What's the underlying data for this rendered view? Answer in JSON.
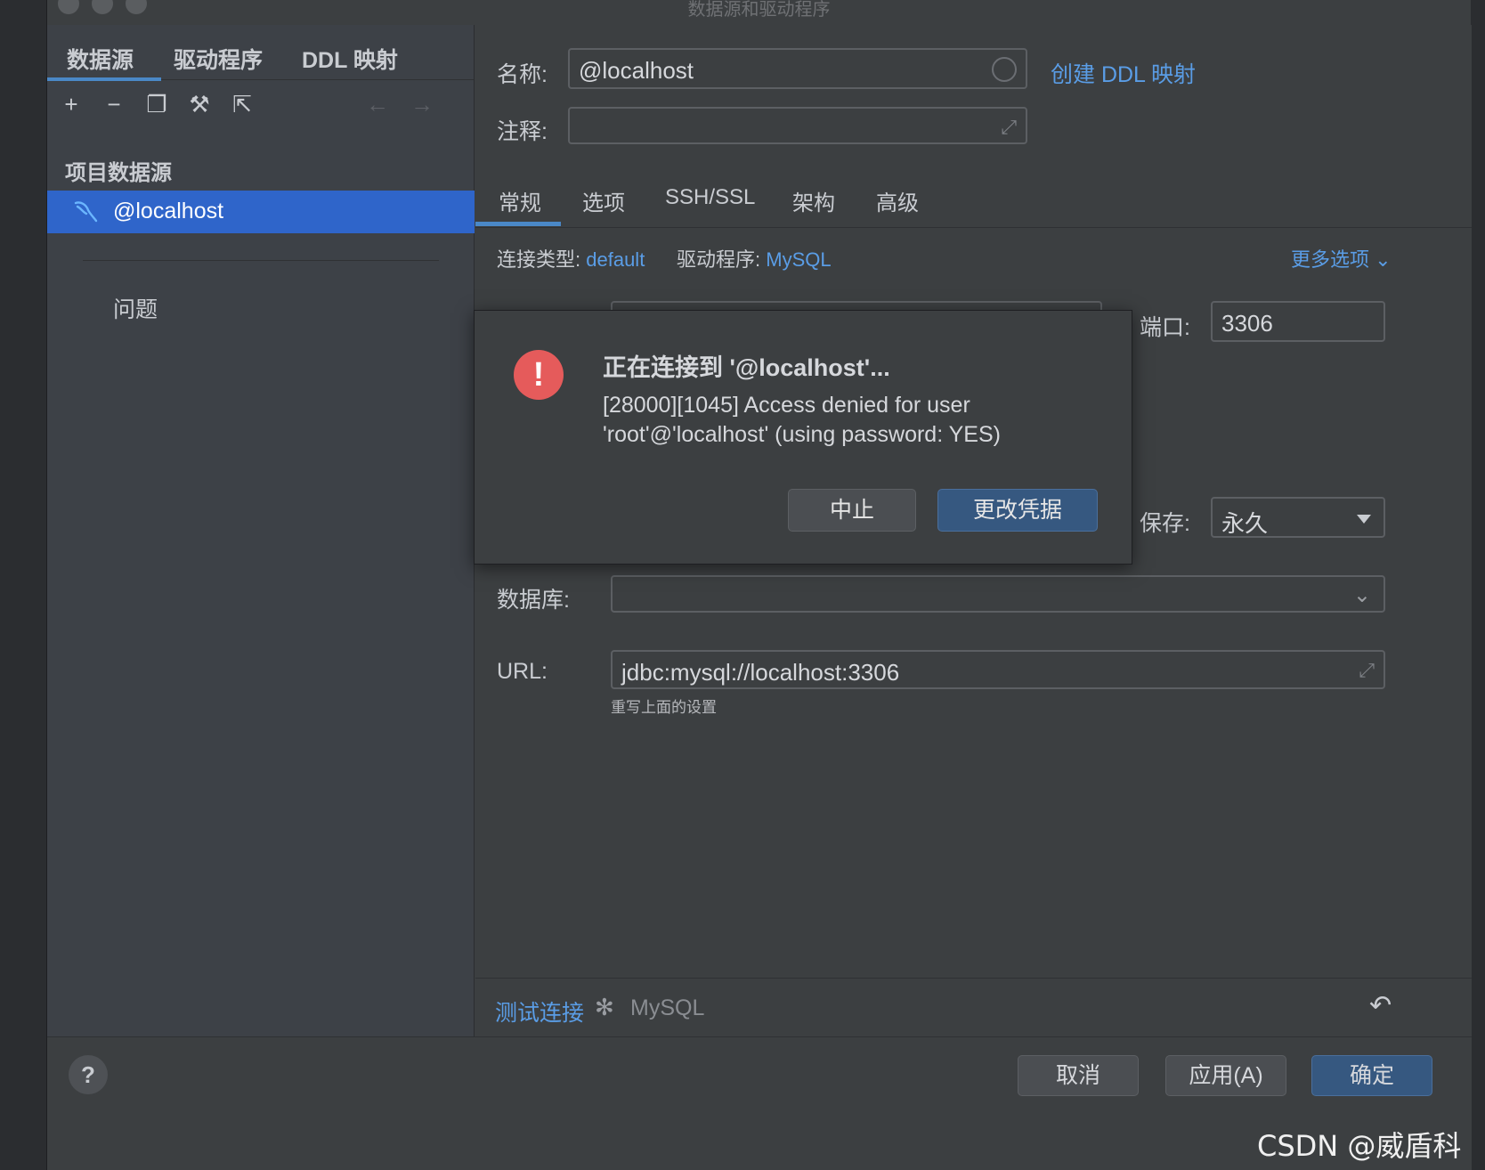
{
  "window": {
    "title": "数据源和驱动程序"
  },
  "left_tabs": [
    "数据源",
    "驱动程序",
    "DDL 映射"
  ],
  "toolbar": {
    "add_icon": "+",
    "remove_icon": "−",
    "copy_icon": "❐",
    "settings_icon": "⚒",
    "export_icon": "⇱",
    "back_icon": "←",
    "forward_icon": "→"
  },
  "sidebar": {
    "section_title": "项目数据源",
    "selected_item": "@localhost",
    "problems_label": "问题"
  },
  "form": {
    "name_label": "名称:",
    "name_value": "@localhost",
    "create_ddl_link": "创建 DDL 映射",
    "comment_label": "注释:",
    "comment_value": "",
    "expand_glyph": "⤢"
  },
  "tabs": [
    "常规",
    "选项",
    "SSH/SSL",
    "架构",
    "高级"
  ],
  "connection": {
    "type_label": "连接类型:",
    "type_value": "default",
    "driver_label": "驱动程序:",
    "driver_value": "MySQL",
    "more_options": "更多选项 ⌄"
  },
  "fields": {
    "port_label": "端口:",
    "port_value": "3306",
    "save_label": "保存:",
    "save_value": "永久",
    "database_label": "数据库:",
    "database_value": "",
    "url_label": "URL:",
    "url_value": "jdbc:mysql://localhost:3306",
    "url_hint": "重写上面的设置"
  },
  "bottom": {
    "test_connection": "测试连接",
    "spinner_glyph": "✻",
    "driver_status": "MySQL",
    "undo_glyph": "↶"
  },
  "footer": {
    "help": "?",
    "cancel": "取消",
    "apply": "应用(A)",
    "ok": "确定"
  },
  "dialog": {
    "icon": "!",
    "title": "正在连接到 '@localhost'...",
    "message": "[28000][1045] Access denied for user 'root'@'localhost' (using password: YES)",
    "abort_button": "中止",
    "change_credentials_button": "更改凭据"
  },
  "watermark": "CSDN @威盾科技",
  "colors": {
    "accent": "#2f65ca",
    "link": "#5a9de6",
    "error": "#e55b5b",
    "primary_button": "#365880"
  }
}
